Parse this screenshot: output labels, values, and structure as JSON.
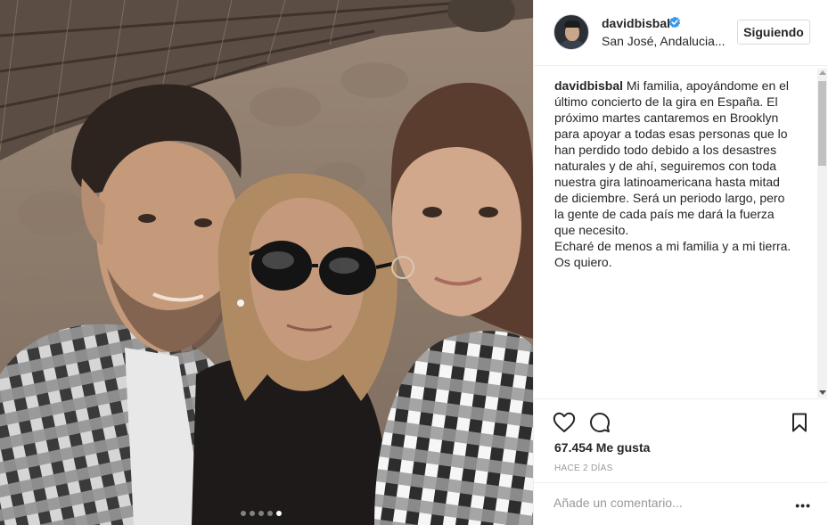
{
  "post": {
    "username": "davidbisbal",
    "location": "San José, Andalucia...",
    "follow_label": "Siguiendo",
    "caption_username": "davidbisbal",
    "caption_text": " Mi familia, apoyándome en el último concierto de la gira en España. El próximo martes cantaremos en Brooklyn para apoyar a todas esas personas que lo han perdido todo debido a los desastres naturales y de ahí, seguiremos con toda nuestra gira latinoamericana hasta mitad de diciembre. Será un periodo largo, pero la gente de cada país me dará la fuerza que necesito.\nEcharé de menos a mi familia y a mi tierra. Os quiero.",
    "likes": "67.454 Me gusta",
    "time": "HACE 2 DÍAS",
    "comment_placeholder": "Añade un comentario...",
    "more_label": "•••"
  },
  "carousel": {
    "total": 5,
    "active_index": 4
  },
  "icons": {
    "verified": "verified-badge-icon",
    "like": "heart-icon",
    "comment": "comment-bubble-icon",
    "save": "bookmark-icon"
  },
  "colors": {
    "verified": "#3897f0",
    "text": "#262626",
    "muted": "#999999",
    "border": "#efefef"
  }
}
